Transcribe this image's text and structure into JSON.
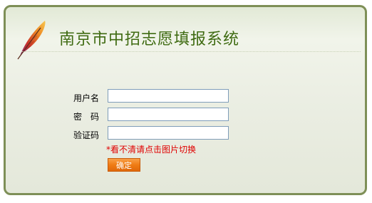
{
  "header": {
    "title": "南京市中招志愿填报系统",
    "logo_icon": "feather-quill-icon"
  },
  "form": {
    "username_label": "用户名",
    "password_label": "密　码",
    "captcha_label": "验证码",
    "username_value": "",
    "password_value": "",
    "captcha_value": "",
    "captcha_hint": "*看不清请点击图片切换",
    "submit_label": "确定"
  },
  "colors": {
    "frame_border": "#7e8f57",
    "title": "#3f6b12",
    "hint": "#e00000",
    "button": "#ef7c14"
  }
}
